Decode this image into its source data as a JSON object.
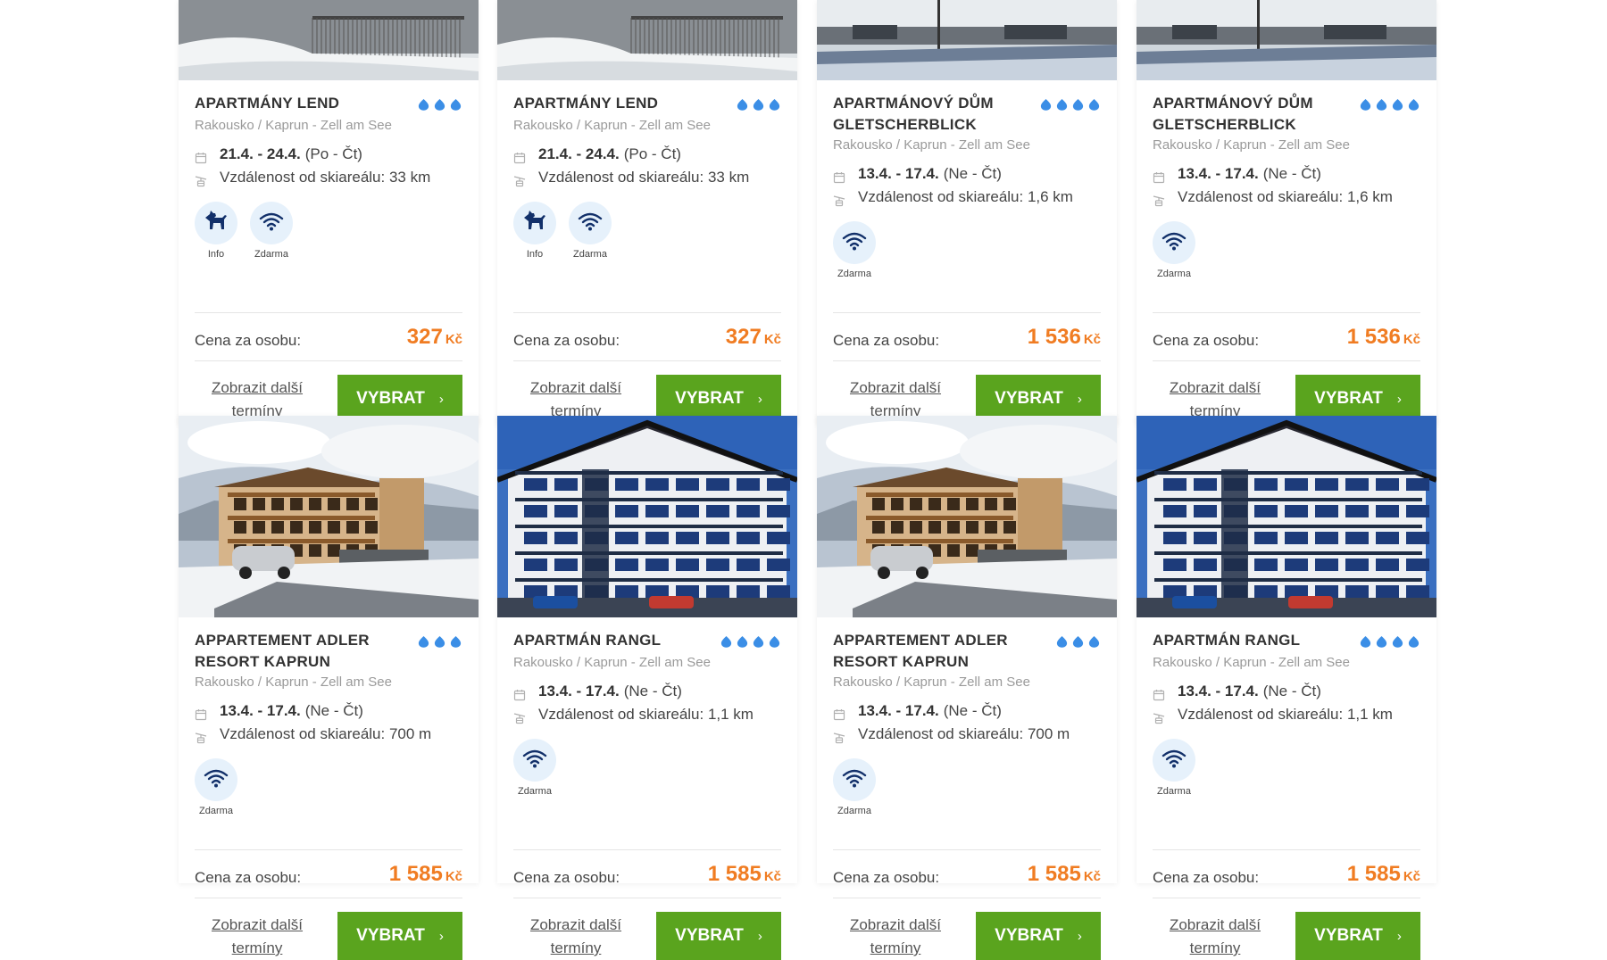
{
  "labels": {
    "price_per_person": "Cena za osobu:",
    "more_dates": "Zobrazit další termíny",
    "select_button": "VYBRAT",
    "currency": "Kč"
  },
  "colors": {
    "accent_blue": "#3b8ee6",
    "price_orange": "#f07c22",
    "button_green": "#5aa41e",
    "amenity_bg": "#e6f1fb"
  },
  "cards": [
    {
      "name": "APARTMÁNY LEND",
      "stars": 3,
      "location": "Rakousko / Kaprun - Zell am See",
      "dates": "21.4. - 24.4.",
      "days": "(Po - Čt)",
      "distance": "Vzdálenost od skiareálu: 33 km",
      "amenities": [
        {
          "icon": "dog-icon",
          "label": "Info"
        },
        {
          "icon": "wifi-icon",
          "label": "Zdarma"
        }
      ],
      "price": "327"
    },
    {
      "name": "APARTMÁNY LEND",
      "stars": 3,
      "location": "Rakousko / Kaprun - Zell am See",
      "dates": "21.4. - 24.4.",
      "days": "(Po - Čt)",
      "distance": "Vzdálenost od skiareálu: 33 km",
      "amenities": [
        {
          "icon": "dog-icon",
          "label": "Info"
        },
        {
          "icon": "wifi-icon",
          "label": "Zdarma"
        }
      ],
      "price": "327"
    },
    {
      "name": "APARTMÁNOVÝ DŮM GLETSCHERBLICK",
      "stars": 4,
      "location": "Rakousko / Kaprun - Zell am See",
      "dates": "13.4. - 17.4.",
      "days": "(Ne - Čt)",
      "distance": "Vzdálenost od skiareálu: 1,6 km",
      "amenities": [
        {
          "icon": "wifi-icon",
          "label": "Zdarma"
        }
      ],
      "price": "1 536"
    },
    {
      "name": "APARTMÁNOVÝ DŮM GLETSCHERBLICK",
      "stars": 4,
      "location": "Rakousko / Kaprun - Zell am See",
      "dates": "13.4. - 17.4.",
      "days": "(Ne - Čt)",
      "distance": "Vzdálenost od skiareálu: 1,6 km",
      "amenities": [
        {
          "icon": "wifi-icon",
          "label": "Zdarma"
        }
      ],
      "price": "1 536"
    },
    {
      "name": "APPARTEMENT ADLER RESORT KAPRUN",
      "stars": 3,
      "location": "Rakousko / Kaprun - Zell am See",
      "dates": "13.4. - 17.4.",
      "days": "(Ne - Čt)",
      "distance": "Vzdálenost od skiareálu: 700 m",
      "amenities": [
        {
          "icon": "wifi-icon",
          "label": "Zdarma"
        }
      ],
      "price": "1 585"
    },
    {
      "name": "APARTMÁN RANGL",
      "stars": 4,
      "location": "Rakousko / Kaprun - Zell am See",
      "dates": "13.4. - 17.4.",
      "days": "(Ne - Čt)",
      "distance": "Vzdálenost od skiareálu: 1,1 km",
      "amenities": [
        {
          "icon": "wifi-icon",
          "label": "Zdarma"
        }
      ],
      "price": "1 585"
    },
    {
      "name": "APPARTEMENT ADLER RESORT KAPRUN",
      "stars": 3,
      "location": "Rakousko / Kaprun - Zell am See",
      "dates": "13.4. - 17.4.",
      "days": "(Ne - Čt)",
      "distance": "Vzdálenost od skiareálu: 700 m",
      "amenities": [
        {
          "icon": "wifi-icon",
          "label": "Zdarma"
        }
      ],
      "price": "1 585"
    },
    {
      "name": "APARTMÁN RANGL",
      "stars": 4,
      "location": "Rakousko / Kaprun - Zell am See",
      "dates": "13.4. - 17.4.",
      "days": "(Ne - Čt)",
      "distance": "Vzdálenost od skiareálu: 1,1 km",
      "amenities": [
        {
          "icon": "wifi-icon",
          "label": "Zdarma"
        }
      ],
      "price": "1 585"
    }
  ]
}
